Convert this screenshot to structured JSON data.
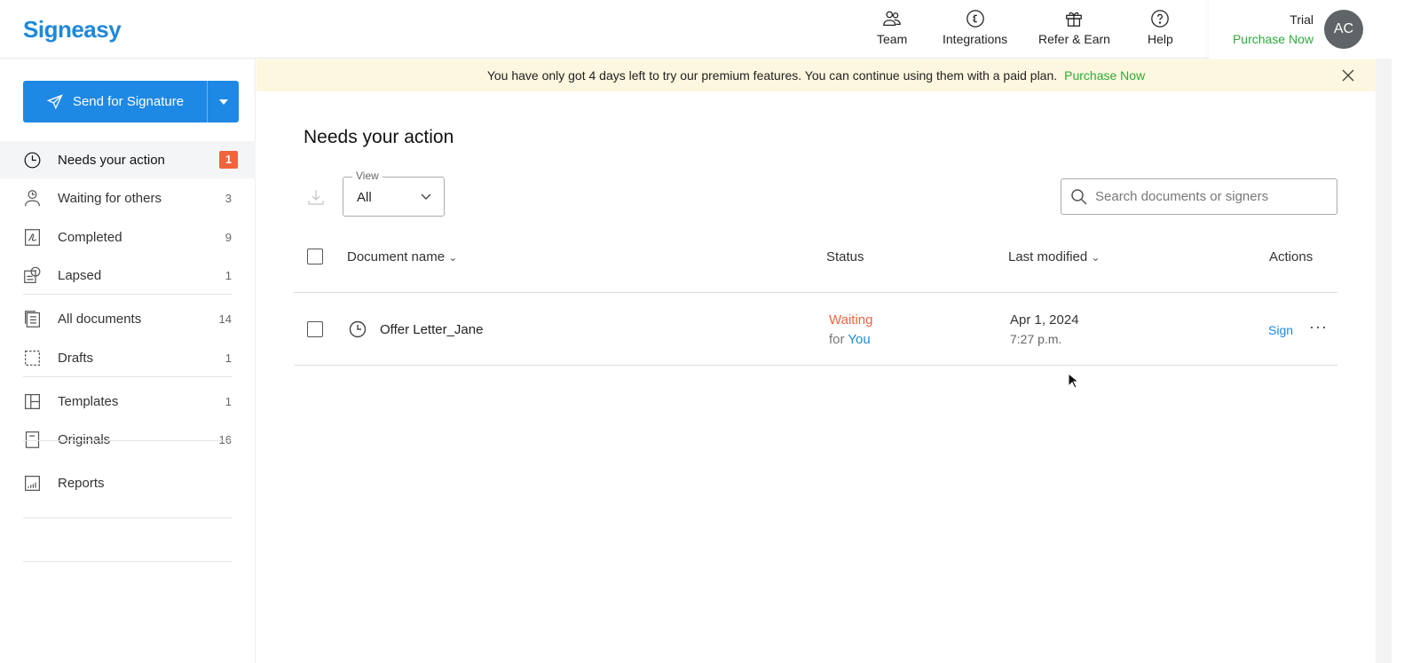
{
  "header": {
    "logo": "Signeasy",
    "nav": [
      {
        "label": "Team",
        "icon": "team-icon"
      },
      {
        "label": "Integrations",
        "icon": "integrations-icon"
      },
      {
        "label": "Refer & Earn",
        "icon": "gift-icon"
      },
      {
        "label": "Help",
        "icon": "help-icon"
      }
    ],
    "plan": "Trial",
    "purchase": "Purchase Now",
    "avatar": "AC"
  },
  "sidebar": {
    "send_label": "Send for Signature",
    "items": [
      {
        "label": "Needs your action",
        "count": "1"
      },
      {
        "label": "Waiting for others",
        "count": "3"
      },
      {
        "label": "Completed",
        "count": "9"
      },
      {
        "label": "Lapsed",
        "count": "1"
      },
      {
        "label": "All documents",
        "count": "14"
      },
      {
        "label": "Drafts",
        "count": "1"
      },
      {
        "label": "Templates",
        "count": "1"
      },
      {
        "label": "Originals",
        "count": "16"
      },
      {
        "label": "Reports",
        "count": ""
      }
    ]
  },
  "banner": {
    "text": "You have only got 4 days left to try our premium features. You can continue using them with a paid plan.",
    "link": "Purchase Now"
  },
  "main": {
    "title": "Needs your action",
    "view_label": "View",
    "view_value": "All",
    "search_placeholder": "Search documents or signers",
    "columns": [
      "Document name",
      "Status",
      "Last modified",
      "Actions"
    ],
    "rows": [
      {
        "name": "Offer Letter_Jane",
        "status": "Waiting",
        "status_for": "for",
        "status_who": "You",
        "date": "Apr 1, 2024",
        "time": "7:27 p.m.",
        "action": "Sign"
      }
    ]
  },
  "colors": {
    "accent": "#1e88e5",
    "green": "#2eaa3a",
    "orange": "#f0643c"
  }
}
